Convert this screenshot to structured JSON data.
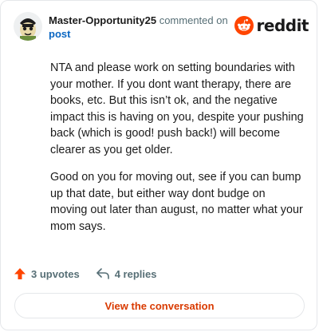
{
  "header": {
    "username": "Master-Opportunity25",
    "action": "commented on",
    "post_link": "post"
  },
  "brand": {
    "wordmark": "reddit",
    "logo_icon": "reddit-snoo-icon",
    "accent": "#ff4500"
  },
  "comment": {
    "paragraphs": [
      "NTA and please work on setting boundaries with your mother. If you dont want therapy, there are books, etc. But this isn’t ok, and the negative impact this is having on you, despite your pushing back (which is good! push back!) will become clearer as you get older.",
      "Good on you for moving out, see if you can bump up that date, but either way dont budge on moving out later than august, no matter what your mom says."
    ]
  },
  "footer": {
    "upvotes": "3 upvotes",
    "replies": "4 replies",
    "upvote_color": "#ff4500"
  },
  "cta": {
    "label": "View the conversation",
    "color": "#d93a00"
  }
}
